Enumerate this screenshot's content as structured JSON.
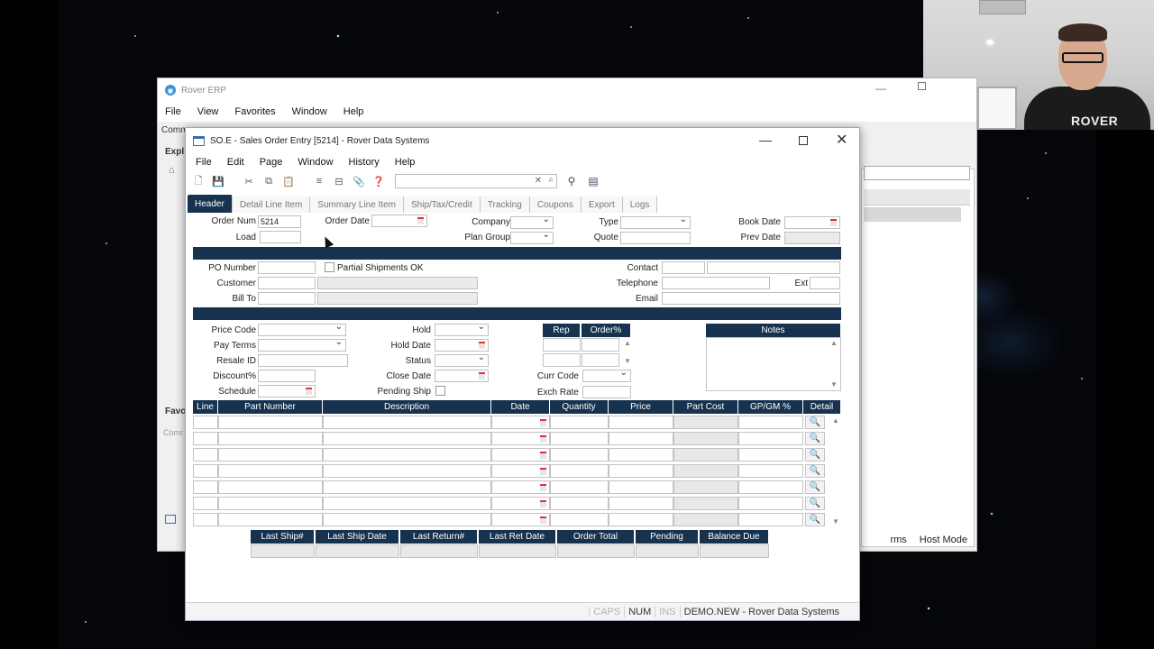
{
  "bg_window": {
    "title": "Rover ERP",
    "menu": [
      "File",
      "View",
      "Favorites",
      "Window",
      "Help"
    ],
    "left_labels": [
      "Comm",
      "Expl",
      "Favo",
      "Comr"
    ],
    "status_items": [
      "rms",
      "Host Mode"
    ]
  },
  "webcam": {
    "shirt_text": "ROVER"
  },
  "so_window": {
    "title": "SO.E - Sales Order Entry [5214] - Rover Data Systems",
    "menu": [
      "File",
      "Edit",
      "Page",
      "Window",
      "History",
      "Help"
    ],
    "tabs": [
      "Header",
      "Detail Line Item",
      "Summary Line Item",
      "Ship/Tax/Credit",
      "Tracking",
      "Coupons",
      "Export",
      "Logs"
    ],
    "active_tab": "Header",
    "header": {
      "order_num_label": "Order Num",
      "order_num_value": "5214",
      "load_label": "Load",
      "order_date_label": "Order Date",
      "company_label": "Company",
      "plan_group_label": "Plan Group",
      "type_label": "Type",
      "quote_label": "Quote",
      "book_date_label": "Book Date",
      "prev_date_label": "Prev Date"
    },
    "customer": {
      "po_number_label": "PO Number",
      "partial_shipments_label": "Partial Shipments OK",
      "customer_label": "Customer",
      "bill_to_label": "Bill To",
      "contact_label": "Contact",
      "telephone_label": "Telephone",
      "ext_label": "Ext",
      "email_label": "Email"
    },
    "terms": {
      "price_code_label": "Price Code",
      "pay_terms_label": "Pay Terms",
      "resale_id_label": "Resale ID",
      "discount_label": "Discount%",
      "schedule_label": "Schedule",
      "hold_label": "Hold",
      "hold_date_label": "Hold Date",
      "status_label": "Status",
      "close_date_label": "Close Date",
      "pending_ship_label": "Pending Ship",
      "rep_header": "Rep",
      "order_pct_header": "Order%",
      "curr_code_label": "Curr Code",
      "exch_rate_label": "Exch Rate",
      "notes_header": "Notes"
    },
    "line_grid": {
      "columns": [
        "Line",
        "Part Number",
        "Description",
        "Date",
        "Quantity",
        "Price",
        "Part Cost",
        "GP/GM %",
        "Detail"
      ],
      "row_count": 7
    },
    "summary_grid": {
      "columns": [
        "Last Ship#",
        "Last Ship Date",
        "Last Return#",
        "Last Ret Date",
        "Order Total",
        "Pending",
        "Balance Due"
      ]
    },
    "status_bar": {
      "caps": "CAPS",
      "num": "NUM",
      "ins": "INS",
      "db": "DEMO.NEW - Rover Data Systems"
    }
  }
}
